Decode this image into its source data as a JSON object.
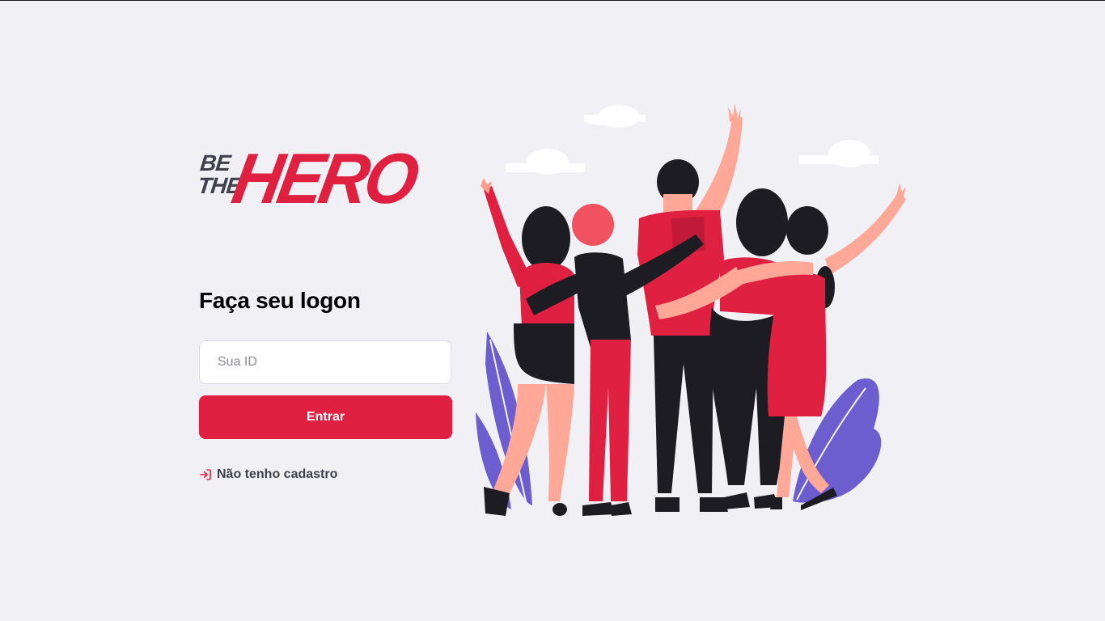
{
  "logo": {
    "be": "BE",
    "the": "THE",
    "hero": "HERO",
    "colors": {
      "primary": "#e02041",
      "dark": "#41414d"
    }
  },
  "login": {
    "title": "Faça seu logon",
    "id_placeholder": "Sua ID",
    "id_value": "",
    "submit_label": "Entrar",
    "register_label": "Não tenho cadastro",
    "register_icon": "log-in-icon"
  },
  "illustration": {
    "name": "heroes-group-illustration"
  },
  "colors": {
    "background": "#f0f0f5",
    "accent": "#e02041",
    "text": "#41414d"
  }
}
